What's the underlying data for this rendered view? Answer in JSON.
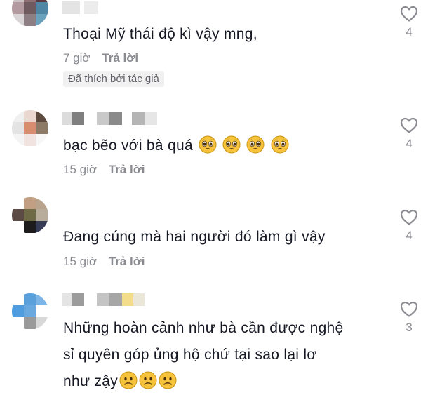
{
  "comments": [
    {
      "text": "Thoại Mỹ thái độ kì vậy mng,",
      "time": "7 giờ",
      "reply": "Trả lời",
      "badge": "Đã thích bởi tác giả",
      "likes": "4"
    },
    {
      "text": "bạc bẽo với bà quá",
      "emoji": "pleading-face-icon",
      "emoji_count": 4,
      "time": "15 giờ",
      "reply": "Trả lời",
      "likes": "4"
    },
    {
      "text": "Đang cúng mà hai người đó làm gì vậy",
      "time": "15 giờ",
      "reply": "Trả lời",
      "likes": "4"
    },
    {
      "text_line1": "Những hoàn cảnh như bà cần được nghệ",
      "text_line2": "sỉ quyên góp ủng hộ chứ tại sao lại lơ",
      "text_line3": "như zậy",
      "emoji": "frowning-face-icon",
      "emoji_count": 3,
      "likes": "3"
    }
  ],
  "colors": {
    "text": "#161823",
    "meta": "#8a8b91",
    "badge_bg": "#f1f1f2",
    "emoji_yellow": "#f7c23c"
  }
}
